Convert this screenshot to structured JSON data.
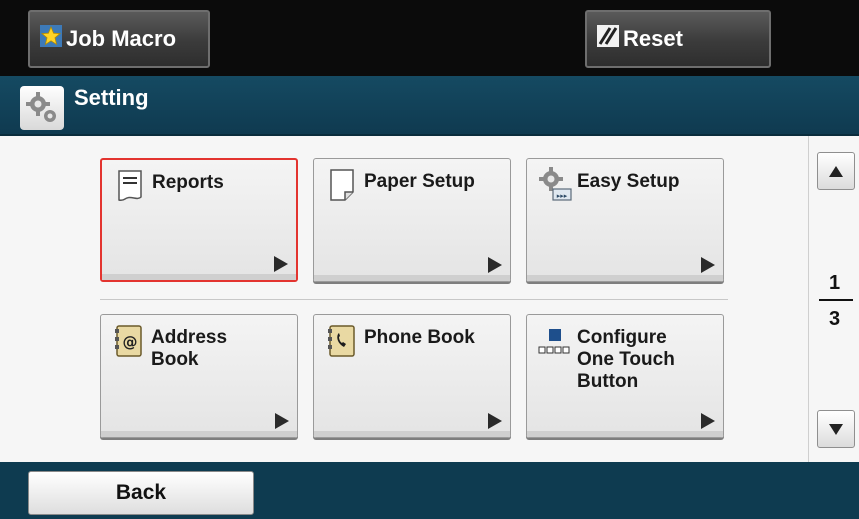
{
  "topbar": {
    "job_macro_label": "Job Macro",
    "reset_label": "Reset"
  },
  "title": {
    "text": "Setting",
    "icon": "gear-icon"
  },
  "tiles": [
    {
      "label": "Reports",
      "icon": "reports-icon",
      "selected": true
    },
    {
      "label": "Paper Setup",
      "icon": "paper-icon",
      "selected": false
    },
    {
      "label": "Easy Setup",
      "icon": "gear-icon",
      "selected": false
    },
    {
      "label": "Address\nBook",
      "icon": "address-book-icon",
      "selected": false
    },
    {
      "label": "Phone Book",
      "icon": "phone-book-icon",
      "selected": false
    },
    {
      "label": "Configure\nOne Touch\nButton",
      "icon": "one-touch-icon",
      "selected": false
    }
  ],
  "pager": {
    "current": "1",
    "total": "3"
  },
  "bottom": {
    "back_label": "Back"
  },
  "colors": {
    "selected_border": "#e3342f",
    "title_bar": "#154a62",
    "bottom_bar": "#0e3b50"
  }
}
